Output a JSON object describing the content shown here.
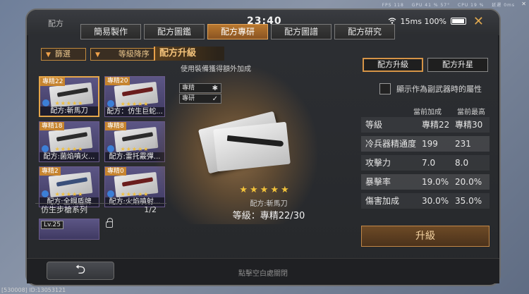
{
  "hud": {
    "fps": "FPS 118",
    "gpu": "GPU 41 % 57°",
    "cpu": "CPU 19 %",
    "signal": "延遲 0ms",
    "close": "✕",
    "footer": "[530008] ID:13053121"
  },
  "window": {
    "title": "配方",
    "clock": "23:40",
    "ping": "15ms",
    "battery": "100%",
    "close": "✕"
  },
  "tabs": [
    {
      "label": "簡易製作"
    },
    {
      "label": "配方圖鑑"
    },
    {
      "label": "配方專研"
    },
    {
      "label": "配方圖譜"
    },
    {
      "label": "配方研究"
    }
  ],
  "filters": {
    "filter_label": "篩選",
    "sort_label": "等級降序"
  },
  "cards": [
    {
      "rank": "專精22",
      "name": "配方:斬馬刀"
    },
    {
      "rank": "專精20",
      "name": "配方：仿生巨蛇..."
    },
    {
      "rank": "專精18",
      "name": "配方:菌焰噴火..."
    },
    {
      "rank": "專精8",
      "name": "配方:雷托霰彈..."
    },
    {
      "rank": "專精2",
      "name": "配方:全鋼盾牌"
    },
    {
      "rank": "專精0",
      "name": "配方:火焰噴射..."
    }
  ],
  "card_stars": "★★★★★",
  "series": {
    "label": "仿生步槍系列",
    "count": "1/2",
    "level": "Lv.25"
  },
  "center": {
    "title": "配方升級",
    "subtitle": "使用裝備獲得額外加成",
    "legend": [
      {
        "label": "專精",
        "mark": "✱"
      },
      {
        "label": "專研",
        "mark": "✓"
      }
    ],
    "stars": "★★★★★",
    "name": "配方:斬馬刀",
    "level": "等級：專精22/30"
  },
  "right": {
    "tab_upgrade": "配方升級",
    "tab_star": "配方升星",
    "checkbox_label": "顯示作為副武器時的屬性",
    "col_current": "當前加成",
    "col_max": "當前最高",
    "attributes": [
      {
        "name": "等級",
        "current": "專精22",
        "max": "專精30"
      },
      {
        "name": "冷兵器精通度",
        "current": "199",
        "max": "231"
      },
      {
        "name": "攻擊力",
        "current": "7.0",
        "max": "8.0"
      },
      {
        "name": "暴擊率",
        "current": "19.0%",
        "max": "20.0%"
      },
      {
        "name": "傷害加成",
        "current": "30.0%",
        "max": "35.0%"
      }
    ],
    "upgrade_button": "升級"
  },
  "bottom": {
    "back": "⮌",
    "hint": "點擊空白處關閉"
  },
  "colors": {
    "accent": "#c6842f",
    "star": "#f2c23a",
    "card_bg": "#4f4a78"
  }
}
